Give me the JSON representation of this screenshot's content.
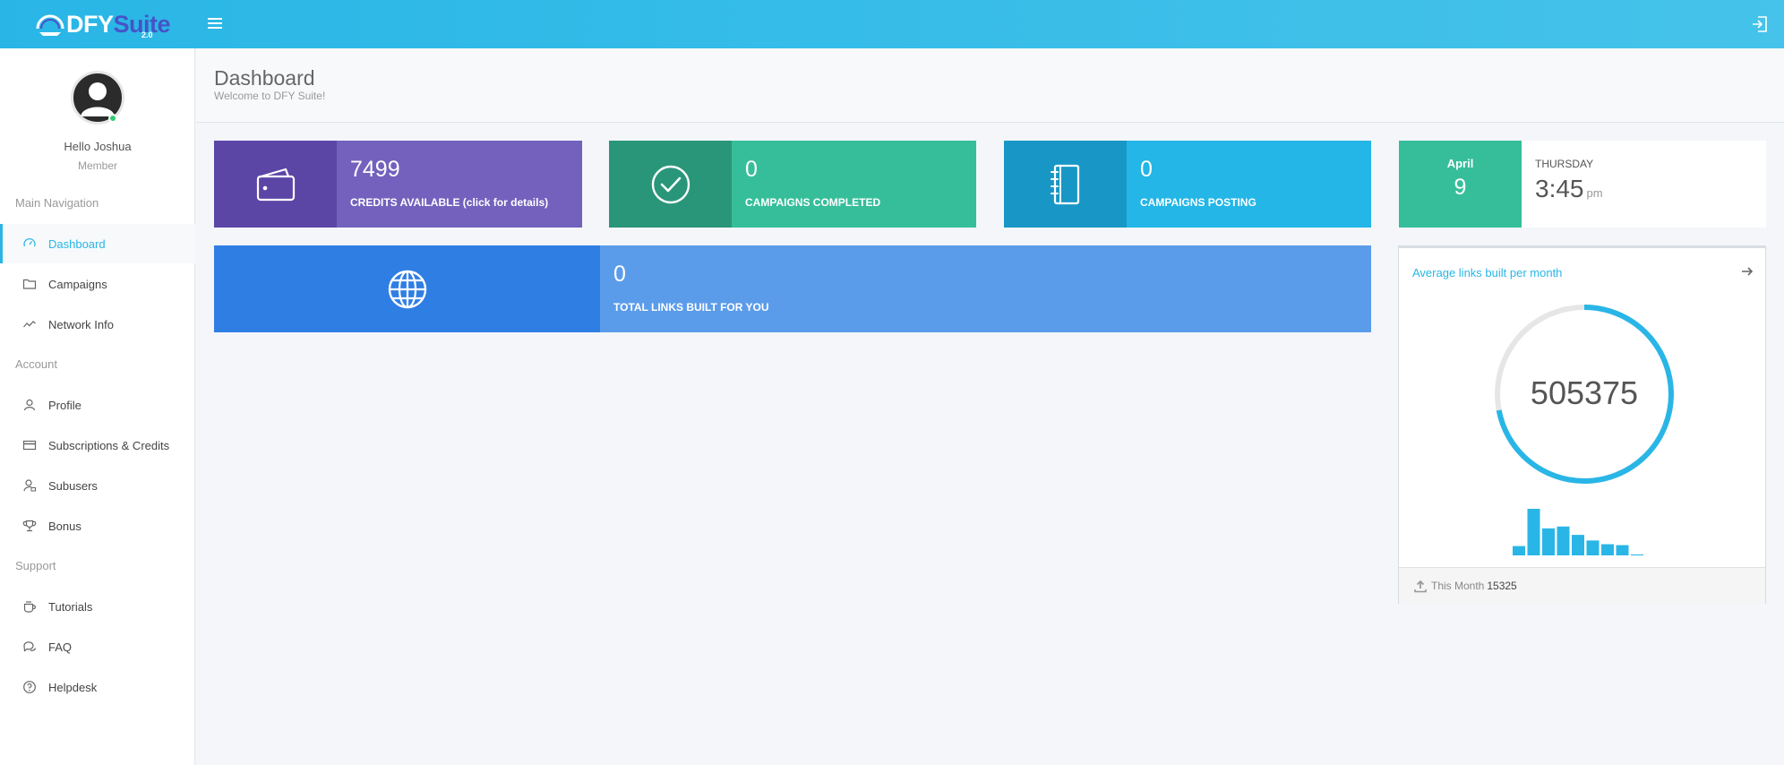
{
  "app": {
    "logo_dfy": "DFY",
    "logo_suite": "Suite",
    "logo_version": "2.0"
  },
  "user": {
    "greeting": "Hello Joshua",
    "role": "Member"
  },
  "sidebar": {
    "sections": [
      {
        "header": "Main Navigation",
        "items": [
          {
            "label": "Dashboard",
            "icon": "speedometer-icon",
            "active": true
          },
          {
            "label": "Campaigns",
            "icon": "folder-icon"
          },
          {
            "label": "Network Info",
            "icon": "line-chart-icon"
          }
        ]
      },
      {
        "header": "Account",
        "items": [
          {
            "label": "Profile",
            "icon": "user-icon"
          },
          {
            "label": "Subscriptions & Credits",
            "icon": "credit-card-icon"
          },
          {
            "label": "Subusers",
            "icon": "user-lock-icon"
          },
          {
            "label": "Bonus",
            "icon": "trophy-icon"
          }
        ]
      },
      {
        "header": "Support",
        "items": [
          {
            "label": "Tutorials",
            "icon": "cup-icon"
          },
          {
            "label": "FAQ",
            "icon": "chat-icon"
          },
          {
            "label": "Helpdesk",
            "icon": "question-circle-icon"
          }
        ]
      }
    ]
  },
  "page": {
    "title": "Dashboard",
    "subtitle": "Welcome to DFY Suite!"
  },
  "cards": {
    "credits": {
      "value": "7499",
      "caption": "CREDITS AVAILABLE (click for details)",
      "icon": "wallet-icon"
    },
    "completed": {
      "value": "0",
      "caption": "CAMPAIGNS COMPLETED",
      "icon": "check-circle-icon"
    },
    "posting": {
      "value": "0",
      "caption": "CAMPAIGNS POSTING",
      "icon": "notebook-icon"
    },
    "links": {
      "value": "0",
      "caption": "TOTAL LINKS BUILT FOR YOU",
      "icon": "globe-icon"
    }
  },
  "date": {
    "month": "April",
    "day": "9",
    "weekday": "THURSDAY",
    "time": "3:45",
    "ampm": "pm"
  },
  "avg": {
    "title": "Average links built per month",
    "value": "505375",
    "ring_fill_fraction": 0.72,
    "footer_label": "This Month",
    "footer_value": "15325"
  },
  "chart_data": {
    "type": "bar",
    "values": [
      10,
      50,
      29,
      31,
      22,
      16,
      12,
      11,
      1
    ]
  },
  "colors": {
    "accent": "#29b6e6",
    "purple_dark": "#5b46a6",
    "purple": "#7361bd",
    "green_dark": "#2a9679",
    "green": "#36be9b",
    "blue_dark": "#1897c6",
    "blue": "#23b6e6",
    "royal_dark": "#2f7ee4",
    "royal": "#5b9cea"
  }
}
